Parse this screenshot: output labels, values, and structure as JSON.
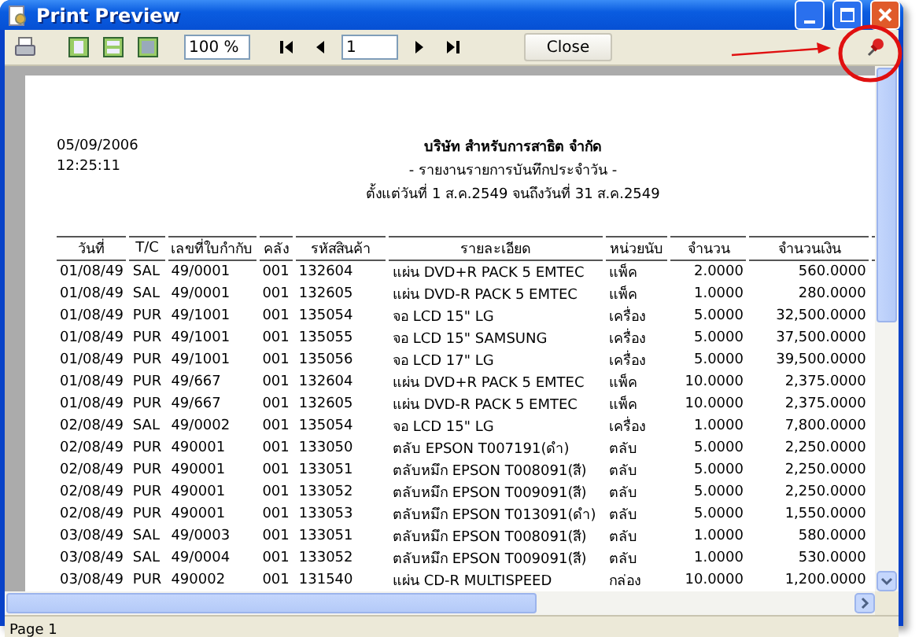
{
  "window": {
    "title": "Print Preview"
  },
  "toolbar": {
    "zoom": "100 %",
    "page": "1",
    "close": "Close"
  },
  "report": {
    "date": "05/09/2006",
    "time": "12:25:11",
    "company": "บริษัท สำหรับการสาธิต จำกัด",
    "title": "- รายงานรายการบันทึกประจำวัน -",
    "period": "ตั้งแต่วันที่ 1 ส.ค.2549 จนถึงวันที่ 31 ส.ค.2549"
  },
  "table": {
    "columns": [
      "วันที่",
      "T/C",
      "เลขที่ใบกำกับ",
      "คลัง",
      "รหัสสินค้า",
      "รายละเอียด",
      "หน่วยนับ",
      "จำนวน",
      "จำนวนเงิน"
    ],
    "rows": [
      [
        "01/08/49",
        "SAL",
        "49/0001",
        "001",
        "132604",
        "แผ่น DVD+R PACK 5 EMTEC",
        "แพ็ค",
        "2.0000",
        "560.0000"
      ],
      [
        "01/08/49",
        "SAL",
        "49/0001",
        "001",
        "132605",
        "แผ่น DVD-R PACK 5 EMTEC",
        "แพ็ค",
        "1.0000",
        "280.0000"
      ],
      [
        "01/08/49",
        "PUR",
        "49/1001",
        "001",
        "135054",
        "จอ LCD 15\" LG",
        "เครื่อง",
        "5.0000",
        "32,500.0000"
      ],
      [
        "01/08/49",
        "PUR",
        "49/1001",
        "001",
        "135055",
        "จอ LCD 15\" SAMSUNG",
        "เครื่อง",
        "5.0000",
        "37,500.0000"
      ],
      [
        "01/08/49",
        "PUR",
        "49/1001",
        "001",
        "135056",
        "จอ LCD  17\" LG",
        "เครื่อง",
        "5.0000",
        "39,500.0000"
      ],
      [
        "01/08/49",
        "PUR",
        "49/667",
        "001",
        "132604",
        "แผ่น DVD+R PACK 5 EMTEC",
        "แพ็ค",
        "10.0000",
        "2,375.0000"
      ],
      [
        "01/08/49",
        "PUR",
        "49/667",
        "001",
        "132605",
        "แผ่น DVD-R PACK 5 EMTEC",
        "แพ็ค",
        "10.0000",
        "2,375.0000"
      ],
      [
        "02/08/49",
        "SAL",
        "49/0002",
        "001",
        "135054",
        "จอ LCD 15\" LG",
        "เครื่อง",
        "1.0000",
        "7,800.0000"
      ],
      [
        "02/08/49",
        "PUR",
        "490001",
        "001",
        "133050",
        "ตลับ EPSON T007191(ดำ)",
        "ตลับ",
        "5.0000",
        "2,250.0000"
      ],
      [
        "02/08/49",
        "PUR",
        "490001",
        "001",
        "133051",
        "ตลับหมึก EPSON T008091(สี)",
        "ตลับ",
        "5.0000",
        "2,250.0000"
      ],
      [
        "02/08/49",
        "PUR",
        "490001",
        "001",
        "133052",
        "ตลับหมึก EPSON T009091(สี)",
        "ตลับ",
        "5.0000",
        "2,250.0000"
      ],
      [
        "02/08/49",
        "PUR",
        "490001",
        "001",
        "133053",
        "ตลับหมึก EPSON T013091(ดำ)",
        "ตลับ",
        "5.0000",
        "1,550.0000"
      ],
      [
        "03/08/49",
        "SAL",
        "49/0003",
        "001",
        "133051",
        "ตลับหมึก EPSON T008091(สี)",
        "ตลับ",
        "1.0000",
        "580.0000"
      ],
      [
        "03/08/49",
        "SAL",
        "49/0004",
        "001",
        "133052",
        "ตลับหมึก EPSON T009091(สี)",
        "ตลับ",
        "1.0000",
        "530.0000"
      ],
      [
        "03/08/49",
        "PUR",
        "490002",
        "001",
        "131540",
        "แผ่น CD-R MULTISPEED",
        "กล่อง",
        "10.0000",
        "1,200.0000"
      ]
    ]
  },
  "status_bar": {
    "text": "Page 1"
  }
}
